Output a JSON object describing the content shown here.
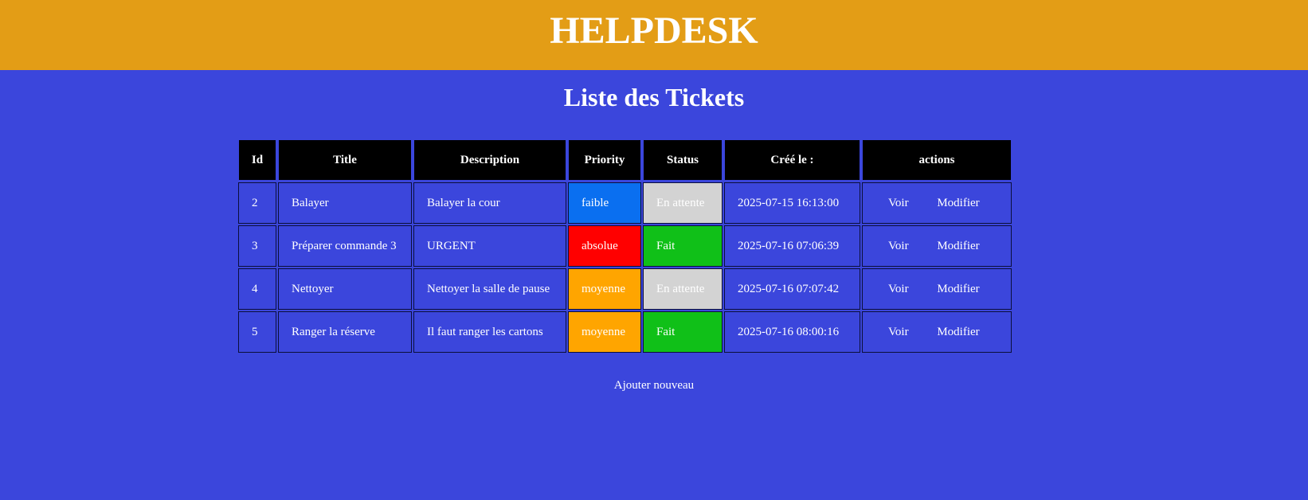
{
  "header": {
    "title": "HELPDESK"
  },
  "page_title": "Liste des Tickets",
  "table": {
    "columns": [
      "Id",
      "Title",
      "Description",
      "Priority",
      "Status",
      "Créé le :",
      "actions"
    ],
    "rows": [
      {
        "id": "2",
        "title": "Balayer",
        "description": "Balayer la cour",
        "priority": "faible",
        "status": "En attente",
        "created": "2025-07-15 16:13:00",
        "view": "Voir",
        "edit": "Modifier"
      },
      {
        "id": "3",
        "title": "Préparer commande 3",
        "description": "URGENT",
        "priority": "absolue",
        "status": "Fait",
        "created": "2025-07-16 07:06:39",
        "view": "Voir",
        "edit": "Modifier"
      },
      {
        "id": "4",
        "title": "Nettoyer",
        "description": "Nettoyer la salle de pause",
        "priority": "moyenne",
        "status": "En attente",
        "created": "2025-07-16 07:07:42",
        "view": "Voir",
        "edit": "Modifier"
      },
      {
        "id": "5",
        "title": "Ranger la réserve",
        "description": "Il faut ranger les cartons",
        "priority": "moyenne",
        "status": "Fait",
        "created": "2025-07-16 08:00:16",
        "view": "Voir",
        "edit": "Modifier"
      }
    ]
  },
  "colors": {
    "background": "#3b46dc",
    "header": "#e39d16",
    "priority": {
      "faible": "#0a6ff0",
      "absolue": "#ff0000",
      "moyenne": "#ffa500"
    },
    "status": {
      "En attente": "#d3d3d3",
      "Fait": "#10c018"
    }
  },
  "add_link": "Ajouter nouveau"
}
